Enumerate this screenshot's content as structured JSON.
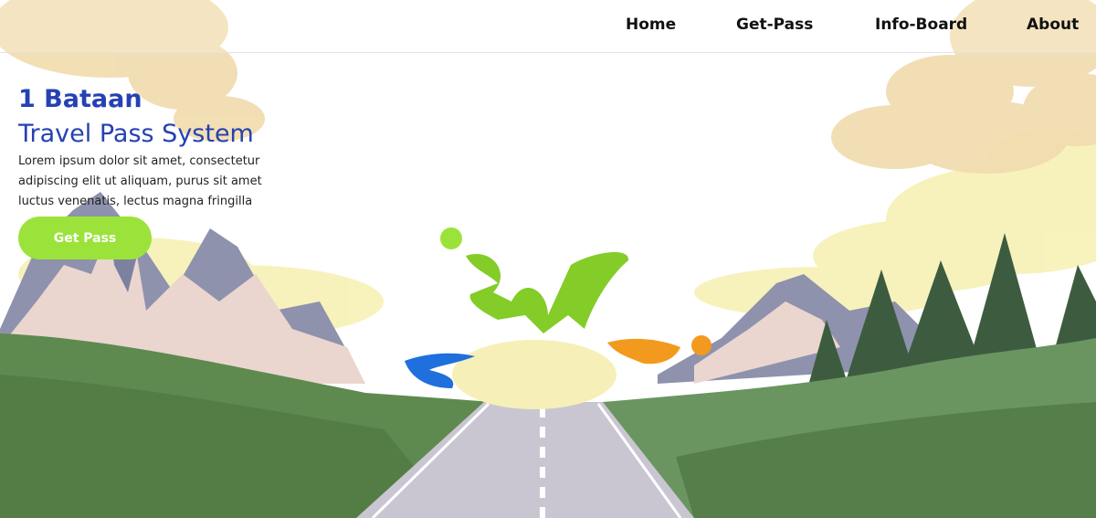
{
  "nav": {
    "items": [
      {
        "label": "Home"
      },
      {
        "label": "Get-Pass"
      },
      {
        "label": "Info-Board"
      },
      {
        "label": "About"
      }
    ]
  },
  "hero": {
    "brand": "1 Bataan",
    "subtitle": "Travel Pass System",
    "description_lines": [
      "Lorem ipsum dolor sit amet, consectetur",
      "adipiscing elit ut aliquam, purus sit amet",
      "luctus venenatis, lectus magna fringilla"
    ],
    "cta_label": "Get Pass"
  },
  "colors": {
    "brand_blue": "#2541b2",
    "cta_green": "#9be33a",
    "hill_green": "#5e8a4f",
    "mountain_gray": "#8e92ad",
    "cloud_peach": "#f1d9a6",
    "road_gray": "#c9c6d2"
  },
  "icons": {
    "logo": "1-bataan-logo-mark"
  }
}
